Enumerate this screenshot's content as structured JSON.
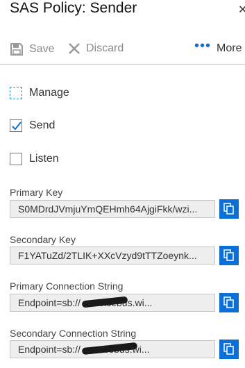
{
  "blade": {
    "title": "SAS Policy: Sender",
    "close_glyph": "✕"
  },
  "toolbar": {
    "save_label": "Save",
    "discard_label": "Discard",
    "more_label": "More",
    "more_glyph": "•••"
  },
  "claims": [
    {
      "label": "Manage",
      "checked": false
    },
    {
      "label": "Send",
      "checked": true
    },
    {
      "label": "Listen",
      "checked": false
    }
  ],
  "fields": [
    {
      "label": "Primary Key",
      "value": "S0MDrdJVmjuYmQEHmh64AjgiFkk/wzi..."
    },
    {
      "label": "Secondary Key",
      "value": "F1YATuZd/2TLIK+XXcVzyd9tTTZoeynk..."
    },
    {
      "label": "Primary Connection String",
      "value": "Endpoint=sb://                    .servicebus.wi..."
    },
    {
      "label": "Secondary Connection String",
      "value": "Endpoint=sb://                    servicebus.wi..."
    }
  ],
  "icons": {
    "save": "save-icon",
    "discard": "discard-icon",
    "more": "more-icon",
    "copy": "copy-icon"
  },
  "colors": {
    "accent": "#0a6fd6",
    "field_bg": "#eeeeee",
    "disabled_text": "#8a8a8a"
  }
}
